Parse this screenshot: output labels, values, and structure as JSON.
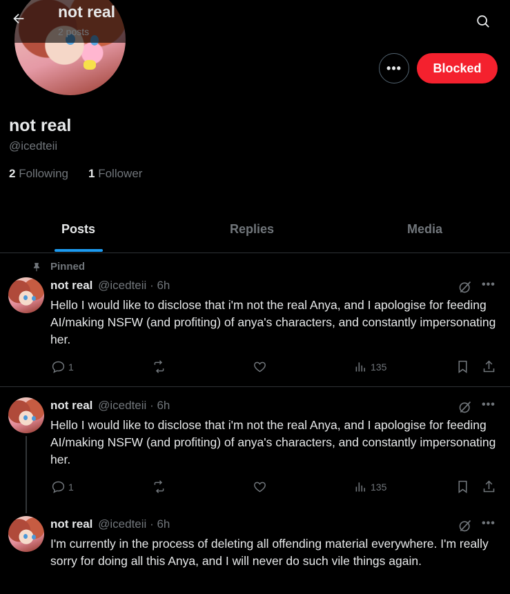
{
  "header": {
    "title": "not real",
    "post_count": "2 posts"
  },
  "profile": {
    "name": "not real",
    "handle": "@icedteii",
    "following_count": "2",
    "following_label": "Following",
    "followers_count": "1",
    "followers_label": "Follower",
    "more_label": "•••",
    "blocked_label": "Blocked"
  },
  "tabs": [
    {
      "label": "Posts",
      "active": true
    },
    {
      "label": "Replies",
      "active": false
    },
    {
      "label": "Media",
      "active": false
    }
  ],
  "posts": [
    {
      "pinned_label": "Pinned",
      "name": "not real",
      "handle": "@icedteii",
      "time": "· 6h",
      "text": "Hello I would like to disclose that i'm not the real Anya, and I apologise for feeding AI/making NSFW (and profiting) of anya's characters, and constantly impersonating her.",
      "replies": "1",
      "views": "135"
    },
    {
      "name": "not real",
      "handle": "@icedteii",
      "time": "· 6h",
      "text": "Hello I would like to disclose that i'm not the real Anya, and I apologise for feeding AI/making NSFW (and profiting) of anya's characters, and constantly impersonating her.",
      "replies": "1",
      "views": "135"
    },
    {
      "name": "not real",
      "handle": "@icedteii",
      "time": "· 6h",
      "text": "I'm currently in the process of deleting all offending material everywhere. I'm really sorry for doing all this Anya, and I will never do such vile things again."
    }
  ],
  "colors": {
    "background": "#000000",
    "accent": "#1d9bf0",
    "blocked": "#f4212e",
    "muted": "#71767b"
  }
}
